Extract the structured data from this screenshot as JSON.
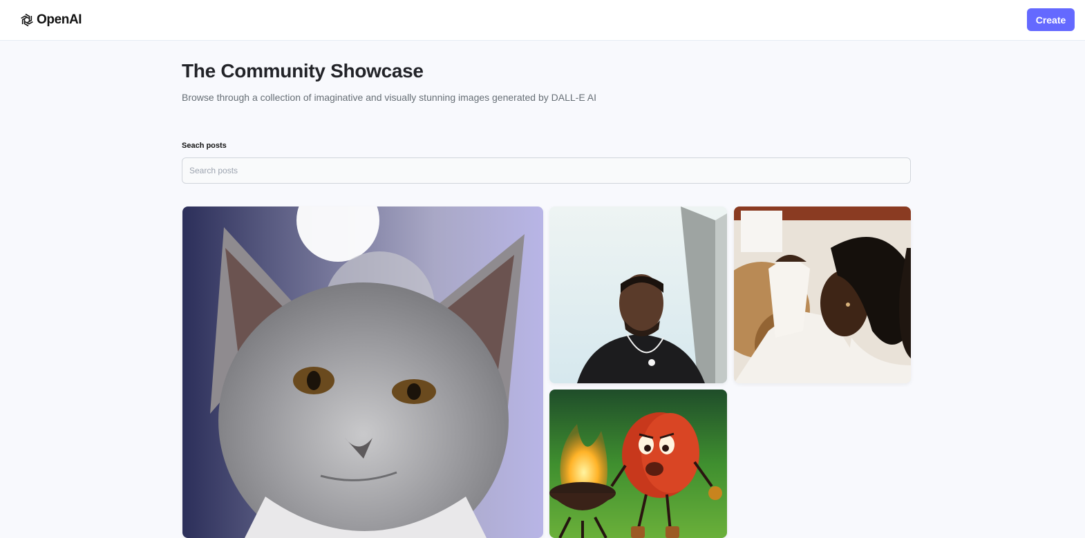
{
  "header": {
    "logo_text": "OpenAI",
    "logo_icon": "openai-logo-icon",
    "create_label": "Create",
    "create_color": "#6469ff"
  },
  "main": {
    "title": "The Community Showcase",
    "subtitle": "Browse through a collection of imaginative and visually stunning images generated by DALL-E AI"
  },
  "search": {
    "label": "Seach posts",
    "placeholder": "Search posts",
    "value": ""
  },
  "gallery": {
    "items": [
      {
        "icon": "cat-image"
      },
      {
        "icon": "man-portrait-image"
      },
      {
        "icon": "woman-portrait-image"
      },
      {
        "icon": "bbq-character-image"
      }
    ]
  }
}
